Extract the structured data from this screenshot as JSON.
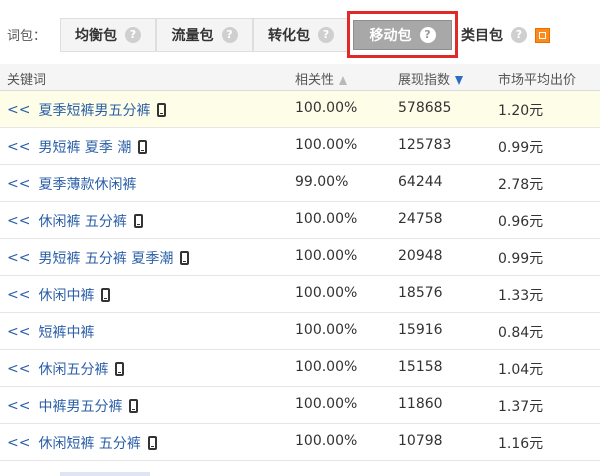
{
  "tabbar": {
    "label": "词包：",
    "tabs": [
      {
        "label": "均衡包",
        "icon": "help-icon",
        "glyph": "?"
      },
      {
        "label": "流量包",
        "icon": "help-icon",
        "glyph": "?"
      },
      {
        "label": "转化包",
        "icon": "help-icon",
        "glyph": "?"
      },
      {
        "label": "移动包",
        "icon": "help-icon",
        "glyph": "?",
        "active": true
      },
      {
        "label": "类目包",
        "icon": "category-icon"
      }
    ],
    "highlight_color": "#e02a2a"
  },
  "table": {
    "headers": {
      "keyword": "关键词",
      "relevance": "相关性",
      "index": "展现指数",
      "price": "市场平均出价"
    },
    "add_prefix": "<<",
    "rows": [
      {
        "keyword": "夏季短裤男五分裤",
        "mobile": true,
        "relevance": "100.00%",
        "index": "578685",
        "price": "1.20元"
      },
      {
        "keyword": "男短裤 夏季 潮",
        "mobile": true,
        "relevance": "100.00%",
        "index": "125783",
        "price": "0.99元"
      },
      {
        "keyword": "夏季薄款休闲裤",
        "mobile": false,
        "relevance": "99.00%",
        "index": "64244",
        "price": "2.78元"
      },
      {
        "keyword": "休闲裤 五分裤",
        "mobile": true,
        "relevance": "100.00%",
        "index": "24758",
        "price": "0.96元"
      },
      {
        "keyword": "男短裤 五分裤 夏季潮",
        "mobile": true,
        "relevance": "100.00%",
        "index": "20948",
        "price": "0.99元"
      },
      {
        "keyword": "休闲中裤",
        "mobile": true,
        "relevance": "100.00%",
        "index": "18576",
        "price": "1.33元"
      },
      {
        "keyword": "短裤中裤",
        "mobile": false,
        "relevance": "100.00%",
        "index": "15916",
        "price": "0.84元"
      },
      {
        "keyword": "休闲五分裤",
        "mobile": true,
        "relevance": "100.00%",
        "index": "15158",
        "price": "1.04元"
      },
      {
        "keyword": "中裤男五分裤",
        "mobile": true,
        "relevance": "100.00%",
        "index": "11860",
        "price": "1.37元"
      },
      {
        "keyword": "休闲短裤 五分裤",
        "mobile": true,
        "relevance": "100.00%",
        "index": "10798",
        "price": "1.16元"
      }
    ]
  }
}
